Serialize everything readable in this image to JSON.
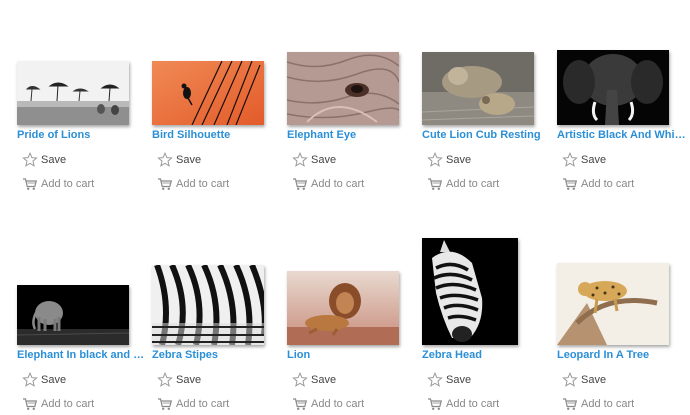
{
  "actions": {
    "save_label": "Save",
    "cart_label": "Add to cart"
  },
  "products": [
    {
      "title": "Pride of Lions"
    },
    {
      "title": "Bird Silhouette"
    },
    {
      "title": "Elephant Eye"
    },
    {
      "title": "Cute Lion Cub Resting"
    },
    {
      "title": "Artistic Black And White Elephant"
    },
    {
      "title": "Elephant In black and white"
    },
    {
      "title": "Zebra Stipes"
    },
    {
      "title": "Lion"
    },
    {
      "title": "Zebra Head"
    },
    {
      "title": "Leopard In A Tree"
    }
  ],
  "colors": {
    "link": "#2b8fd6",
    "save_text": "#444444",
    "cart_text": "#888888"
  }
}
